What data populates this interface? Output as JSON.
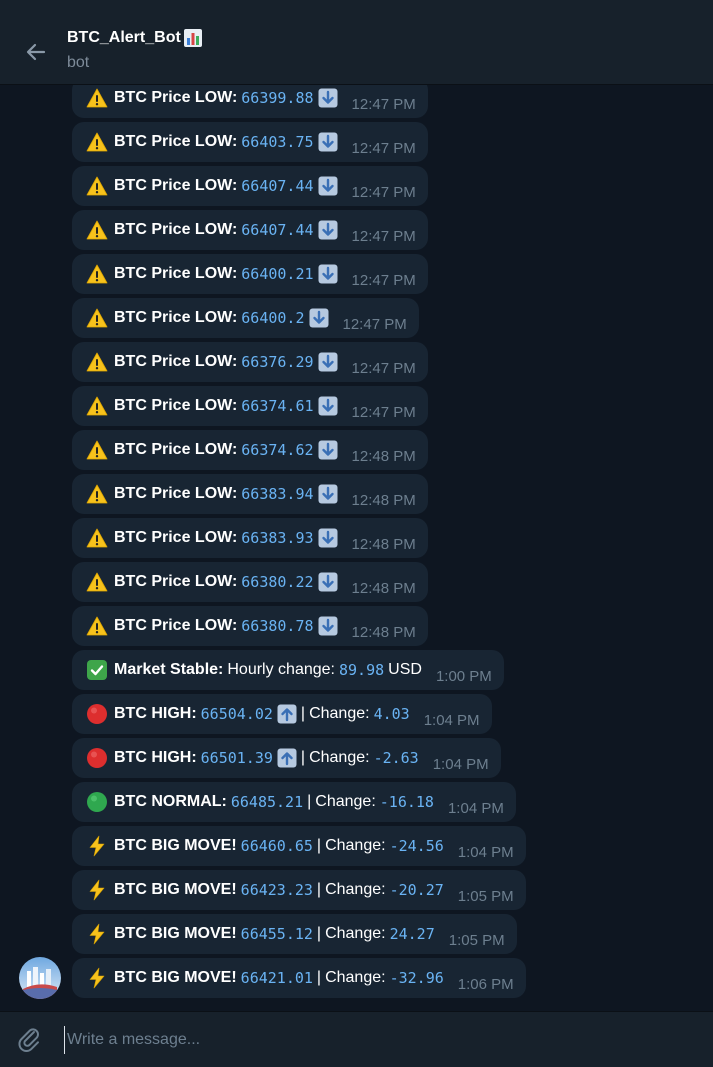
{
  "header": {
    "title": "BTC_Alert_Bot",
    "subtitle": "bot"
  },
  "composer": {
    "placeholder": "Write a message..."
  },
  "messages": [
    {
      "type": "low",
      "label": "BTC Price LOW:",
      "value": "66399.88",
      "time": "12:47 PM"
    },
    {
      "type": "low",
      "label": "BTC Price LOW:",
      "value": "66403.75",
      "time": "12:47 PM"
    },
    {
      "type": "low",
      "label": "BTC Price LOW:",
      "value": "66407.44",
      "time": "12:47 PM"
    },
    {
      "type": "low",
      "label": "BTC Price LOW:",
      "value": "66407.44",
      "time": "12:47 PM"
    },
    {
      "type": "low",
      "label": "BTC Price LOW:",
      "value": "66400.21",
      "time": "12:47 PM"
    },
    {
      "type": "low",
      "label": "BTC Price LOW:",
      "value": "66400.2",
      "time": "12:47 PM"
    },
    {
      "type": "low",
      "label": "BTC Price LOW:",
      "value": "66376.29",
      "time": "12:47 PM"
    },
    {
      "type": "low",
      "label": "BTC Price LOW:",
      "value": "66374.61",
      "time": "12:47 PM"
    },
    {
      "type": "low",
      "label": "BTC Price LOW:",
      "value": "66374.62",
      "time": "12:48 PM"
    },
    {
      "type": "low",
      "label": "BTC Price LOW:",
      "value": "66383.94",
      "time": "12:48 PM"
    },
    {
      "type": "low",
      "label": "BTC Price LOW:",
      "value": "66383.93",
      "time": "12:48 PM"
    },
    {
      "type": "low",
      "label": "BTC Price LOW:",
      "value": "66380.22",
      "time": "12:48 PM"
    },
    {
      "type": "low",
      "label": "BTC Price LOW:",
      "value": "66380.78",
      "time": "12:48 PM"
    },
    {
      "type": "stable",
      "label": "Market Stable:",
      "mid": "Hourly change:",
      "value": "89.98",
      "unit": "USD",
      "time": "1:00 PM"
    },
    {
      "type": "high",
      "label": "BTC HIGH:",
      "value": "66504.02",
      "change_label": "Change:",
      "change": "4.03",
      "time": "1:04 PM"
    },
    {
      "type": "high",
      "label": "BTC HIGH:",
      "value": "66501.39",
      "change_label": "Change:",
      "change": "-2.63",
      "time": "1:04 PM"
    },
    {
      "type": "normal",
      "label": "BTC NORMAL:",
      "value": "66485.21",
      "change_label": "Change:",
      "change": "-16.18",
      "time": "1:04 PM"
    },
    {
      "type": "big",
      "label": "BTC BIG MOVE!",
      "value": "66460.65",
      "change_label": "Change:",
      "change": "-24.56",
      "time": "1:04 PM"
    },
    {
      "type": "big",
      "label": "BTC BIG MOVE!",
      "value": "66423.23",
      "change_label": "Change:",
      "change": "-20.27",
      "time": "1:05 PM"
    },
    {
      "type": "big",
      "label": "BTC BIG MOVE!",
      "value": "66455.12",
      "change_label": "Change:",
      "change": "24.27",
      "time": "1:05 PM"
    },
    {
      "type": "big",
      "label": "BTC BIG MOVE!",
      "value": "66421.01",
      "change_label": "Change:",
      "change": "-32.96",
      "time": "1:06 PM"
    }
  ],
  "icons": {
    "low": "warning-icon",
    "stable": "check-mark-icon",
    "high": "red-circle-icon",
    "normal": "green-circle-icon",
    "big": "lightning-icon"
  }
}
